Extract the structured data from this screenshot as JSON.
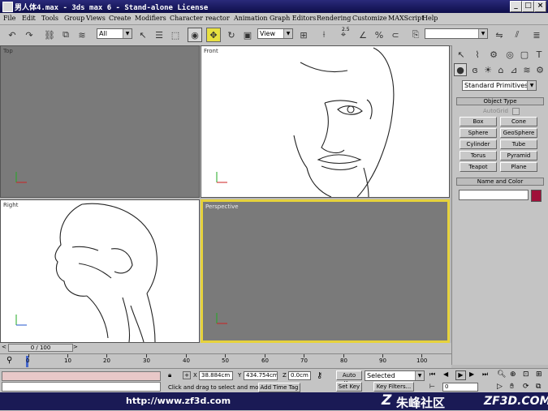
{
  "window": {
    "title": "男人体4.max - 3ds max 6 - Stand-alone License",
    "controls": [
      "minimize",
      "maximize",
      "close"
    ]
  },
  "menu": [
    "File",
    "Edit",
    "Tools",
    "Group",
    "Views",
    "Create",
    "Modifiers",
    "Character",
    "reactor",
    "Animation",
    "Graph Editors",
    "Rendering",
    "Customize",
    "MAXScript",
    "Help"
  ],
  "toolbar": {
    "selection_filter": "All",
    "ref_coord": "View",
    "snap_value": "2.5"
  },
  "viewports": {
    "top": "Top",
    "front": "Front",
    "right": "Right",
    "perspective": "Perspective"
  },
  "command_panel": {
    "category": "Standard Primitives",
    "object_type_title": "Object Type",
    "autogrid": "AutoGrid",
    "buttons": [
      "Box",
      "Cone",
      "Sphere",
      "GeoSphere",
      "Cylinder",
      "Tube",
      "Torus",
      "Pyramid",
      "Teapot",
      "Plane"
    ],
    "name_color_title": "Name and Color",
    "color": "#a0103a"
  },
  "timeline": {
    "frame_counter": "0 / 100",
    "ticks": [
      "0",
      "10",
      "20",
      "30",
      "40",
      "50",
      "60",
      "70",
      "80",
      "90",
      "100"
    ]
  },
  "status": {
    "x_label": "X",
    "x_value": "38.884cm",
    "y_label": "Y",
    "y_value": "434.754cm",
    "z_label": "Z",
    "z_value": "0.0cm",
    "prompt": "Click and drag to select and move",
    "add_time_tag": "Add Time Tag",
    "auto_key": "Auto Key",
    "set_key": "Set Key",
    "key_mode": "Selected",
    "key_filters": "Key Filters...",
    "current_frame": "0"
  },
  "watermark": {
    "url": "http://www.zf3d.com",
    "site_cn": "朱峰社区",
    "site_en": "ZF3D.COM"
  },
  "colors": {
    "title_bg": "#0e0e4a",
    "active_viewport_border": "#e6d23c",
    "viewport_grey": "#7a7a7a"
  }
}
